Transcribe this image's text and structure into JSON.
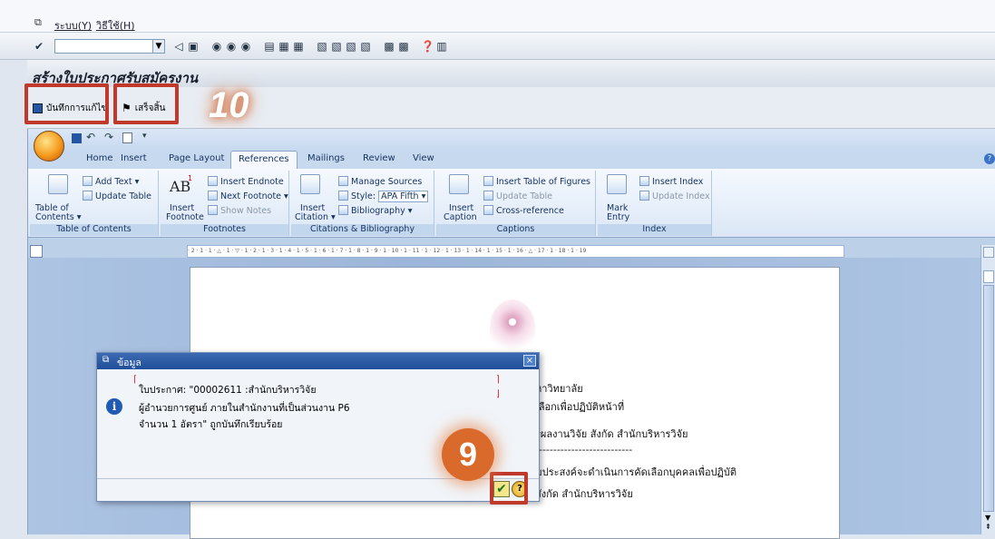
{
  "menubar": {
    "items": [
      "ระบบ(Y)",
      "วิธีใช้(H)"
    ]
  },
  "toolbar": {
    "command_value": ""
  },
  "window": {
    "title": "สร้างใบประกาศรับสมัครงาน"
  },
  "app_toolbar": {
    "save_label": "บันทึกการแก้ไข",
    "finish_label": "เสร็จสิ้น"
  },
  "annotations": {
    "step9": "9",
    "step10": "10"
  },
  "word": {
    "tabs": [
      "Home",
      "Insert",
      "Page Layout",
      "References",
      "Mailings",
      "Review",
      "View"
    ],
    "active_tab": "References",
    "groups": {
      "toc": {
        "label": "Table of Contents",
        "table_of": "Table of",
        "contents": "Contents ▾",
        "add_text": "Add Text ▾",
        "update_table": "Update Table"
      },
      "footnotes": {
        "label": "Footnotes",
        "ab": "AB",
        "insert": "Insert",
        "footnote": "Footnote",
        "insert_endnote": "Insert Endnote",
        "next_footnote": "Next Footnote ▾",
        "show_notes": "Show Notes"
      },
      "citations": {
        "label": "Citations & Bibliography",
        "insert": "Insert",
        "citation": "Citation ▾",
        "manage_sources": "Manage Sources",
        "style_label": "Style:",
        "style_value": "APA Fifth ▾",
        "bibliography": "Bibliography ▾"
      },
      "captions": {
        "label": "Captions",
        "insert": "Insert",
        "caption": "Caption",
        "insert_tof": "Insert Table of Figures",
        "update_table": "Update Table",
        "cross_reference": "Cross-reference"
      },
      "index": {
        "label": "Index",
        "mark": "Mark",
        "entry": "Entry",
        "insert_index": "Insert Index",
        "update_index": "Update Index"
      }
    },
    "ruler": "· 2 · 1 · 1 · △ · 1 · ▽ · 1 · 2 · 1 · 3 · 1 · 4 · 1 · 5 · 1 · 6 · 1 · 7 · 1 · 8 · 1 · 9 · 1 · 10 · 1 · 11 · 1 · 12 · 1 · 13 · 1 · 14 · 1 · 15 · 1 · 16 · △ · 17 · 1 · 18 · 1 · 19",
    "document_lines": [
      "หาวิทยาลัย",
      "เลือกเพื่อปฏิบัติหน้าที่",
      "ร์ผลงานวิจัย สังกัด สำนักบริหารวิจัย",
      "---------------------------",
      "ด้วย  สำนักบริหารวิจัย  จุฬาลงกรณ์มหาวิทยาลัย   มีความประสงค์จะดำเนินการคัดเลือกบุคคลเพื่อปฏิบัติ",
      "หน้าที่ตำแหน่ง ผู้อำนวยการศูนย์บริหารและพัฒนาโครงการวิจัย สังกัด สำนักบริหารวิจัย"
    ]
  },
  "dialog": {
    "title": "ข้อมูล",
    "lines": [
      "ใบประกาศ: \"00002611 :สำนักบริหารวิจัย",
      "ผู้อำนวยการศูนย์ ภายในสำนักงานที่เป็นส่วนงาน P6",
      "จำนวน 1 อัตรา\" ถูกบันทึกเรียบร้อย"
    ]
  }
}
